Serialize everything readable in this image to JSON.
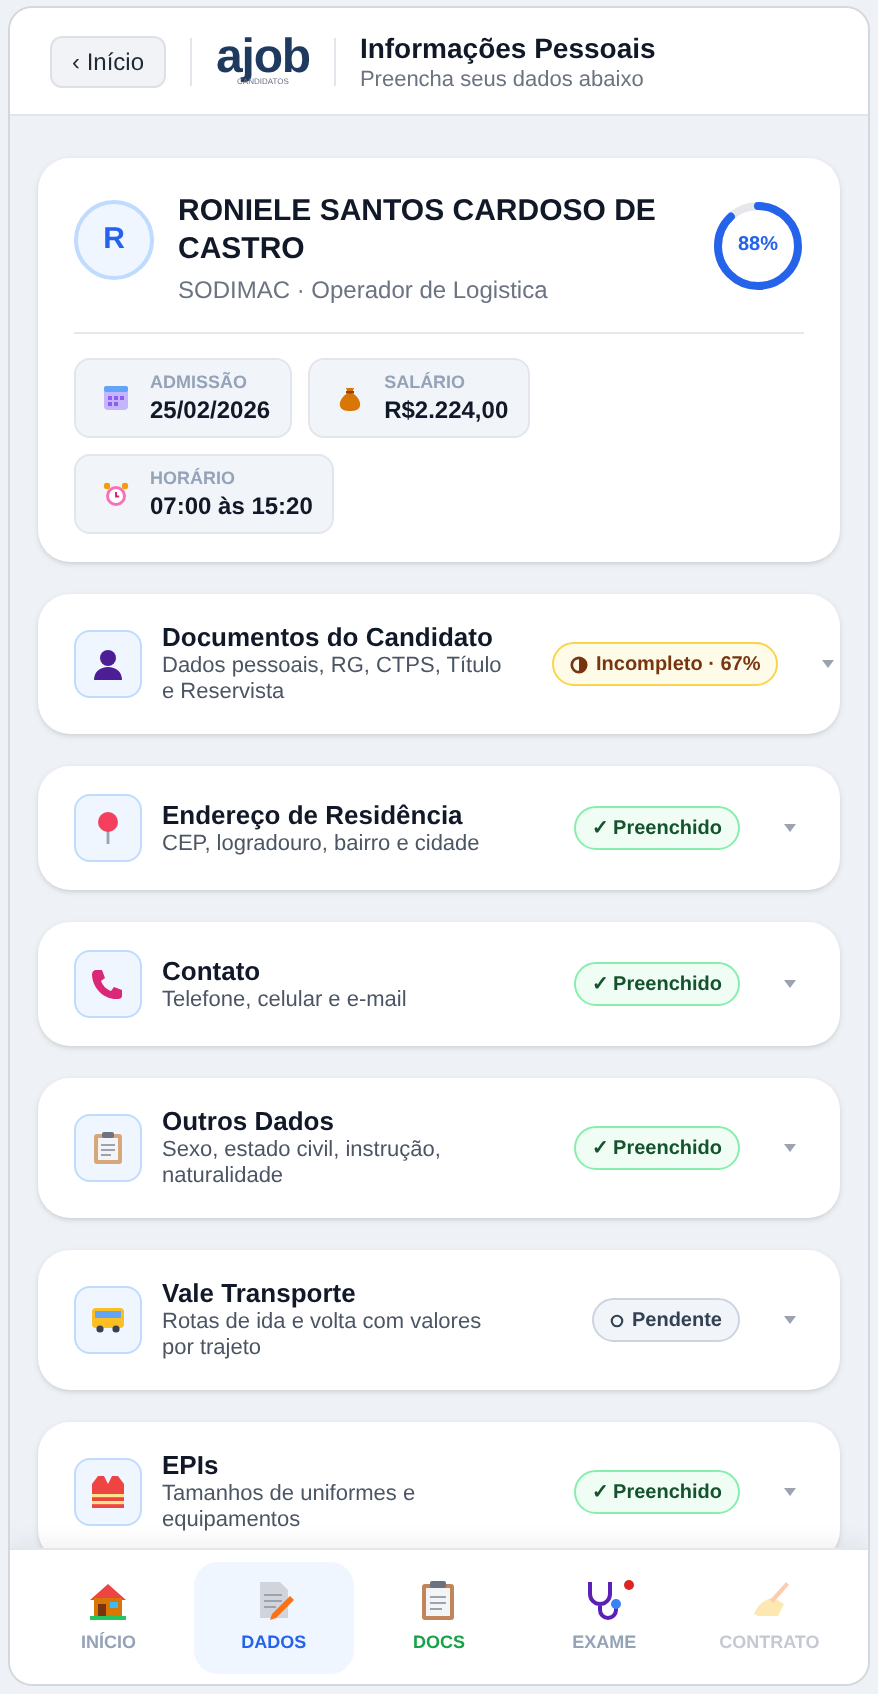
{
  "header": {
    "back": "‹ Início",
    "logo": "ajob",
    "logo_sub": "CANDIDATOS",
    "title": "Informações Pessoais",
    "subtitle": "Preencha seus dados abaixo"
  },
  "profile": {
    "initial": "R",
    "name": "RONIELE SANTOS CARDOSO DE CASTRO",
    "company": "SODIMAC · Operador de Logistica",
    "progress": {
      "level": 0.88,
      "label": "88%"
    },
    "facts": [
      {
        "label": "ADMISSÃO",
        "value": "25/02/2026"
      },
      {
        "label": "SALÁRIO",
        "value": "R$2.224,00"
      },
      {
        "label": "HORÁRIO",
        "value": "07:00 às 15:20"
      }
    ]
  },
  "sections": [
    {
      "title": "Documentos do Candidato",
      "desc": "Dados pessoais, RG, CTPS, Título e Reservista",
      "status": {
        "kind": "incomplete",
        "label": "Incompleto · 67%"
      }
    },
    {
      "title": "Endereço de Residência",
      "desc": "CEP, logradouro, bairro e cidade",
      "status": {
        "kind": "filled",
        "label": "✓ Preenchido"
      }
    },
    {
      "title": "Contato",
      "desc": "Telefone, celular e e-mail",
      "status": {
        "kind": "filled",
        "label": "✓ Preenchido"
      }
    },
    {
      "title": "Outros Dados",
      "desc": "Sexo, estado civil, instrução, naturalidade",
      "status": {
        "kind": "filled",
        "label": "✓ Preenchido"
      }
    },
    {
      "title": "Vale Transporte",
      "desc": "Rotas de ida e volta com valores por trajeto",
      "status": {
        "kind": "pending",
        "label": "Pendente"
      }
    },
    {
      "title": "EPIs",
      "desc": "Tamanhos de uniformes e equipamentos",
      "status": {
        "kind": "filled",
        "label": "✓ Preenchido"
      }
    }
  ],
  "nav": [
    {
      "label": "INÍCIO",
      "selected": false,
      "kind": "normal",
      "alert": false
    },
    {
      "label": "DADOS",
      "selected": true,
      "kind": "normal",
      "alert": false
    },
    {
      "label": "DOCS",
      "selected": false,
      "kind": "done",
      "alert": false
    },
    {
      "label": "EXAME",
      "selected": false,
      "kind": "normal",
      "alert": true
    },
    {
      "label": "CONTRATO",
      "selected": false,
      "kind": "disabled",
      "alert": false
    }
  ]
}
